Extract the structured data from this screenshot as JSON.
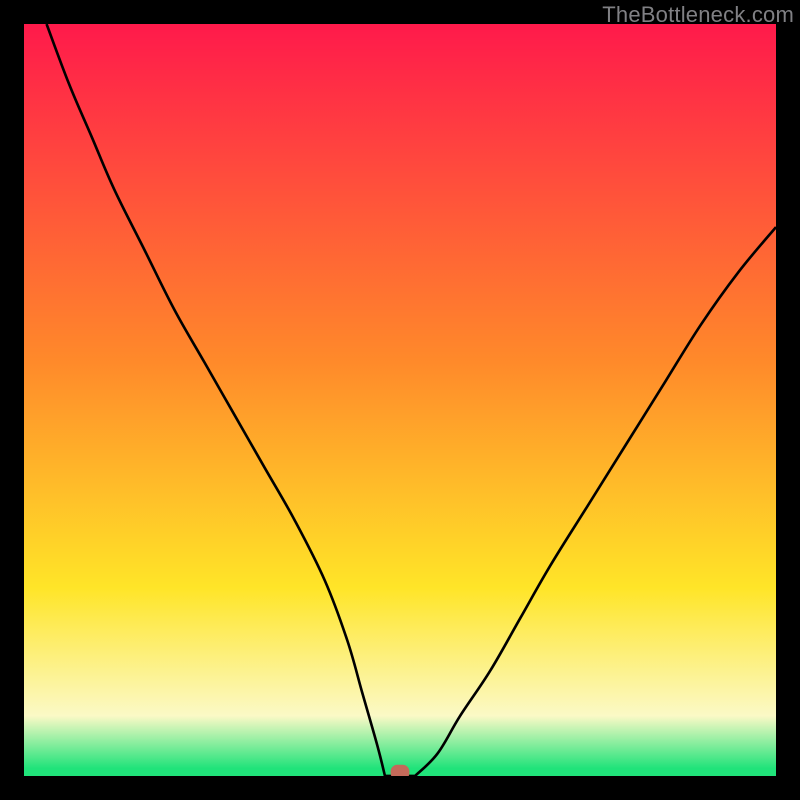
{
  "watermark": "TheBottleneck.com",
  "colors": {
    "top": "#ff1a4b",
    "mid1": "#ff8a2a",
    "mid2": "#ffe528",
    "pale": "#fbf9c6",
    "green": "#20e37a",
    "curve": "#000000",
    "marker": "#c46a5a"
  },
  "chart_data": {
    "type": "line",
    "title": "",
    "xlabel": "",
    "ylabel": "",
    "xlim": [
      0,
      100
    ],
    "ylim": [
      0,
      100
    ],
    "series": [
      {
        "name": "bottleneck-curve",
        "x": [
          3,
          6,
          9,
          12,
          16,
          20,
          24,
          28,
          32,
          36,
          40,
          43,
          45,
          47,
          48,
          52,
          55,
          58,
          62,
          66,
          70,
          75,
          80,
          85,
          90,
          95,
          100
        ],
        "y": [
          100,
          92,
          85,
          78,
          70,
          62,
          55,
          48,
          41,
          34,
          26,
          18,
          11,
          4,
          0,
          0,
          3,
          8,
          14,
          21,
          28,
          36,
          44,
          52,
          60,
          67,
          73
        ]
      }
    ],
    "flat_segment": {
      "x_start": 48,
      "x_end": 52,
      "y": 0
    },
    "marker": {
      "x": 50,
      "y": 0.5,
      "w": 2.5,
      "h": 2
    }
  }
}
